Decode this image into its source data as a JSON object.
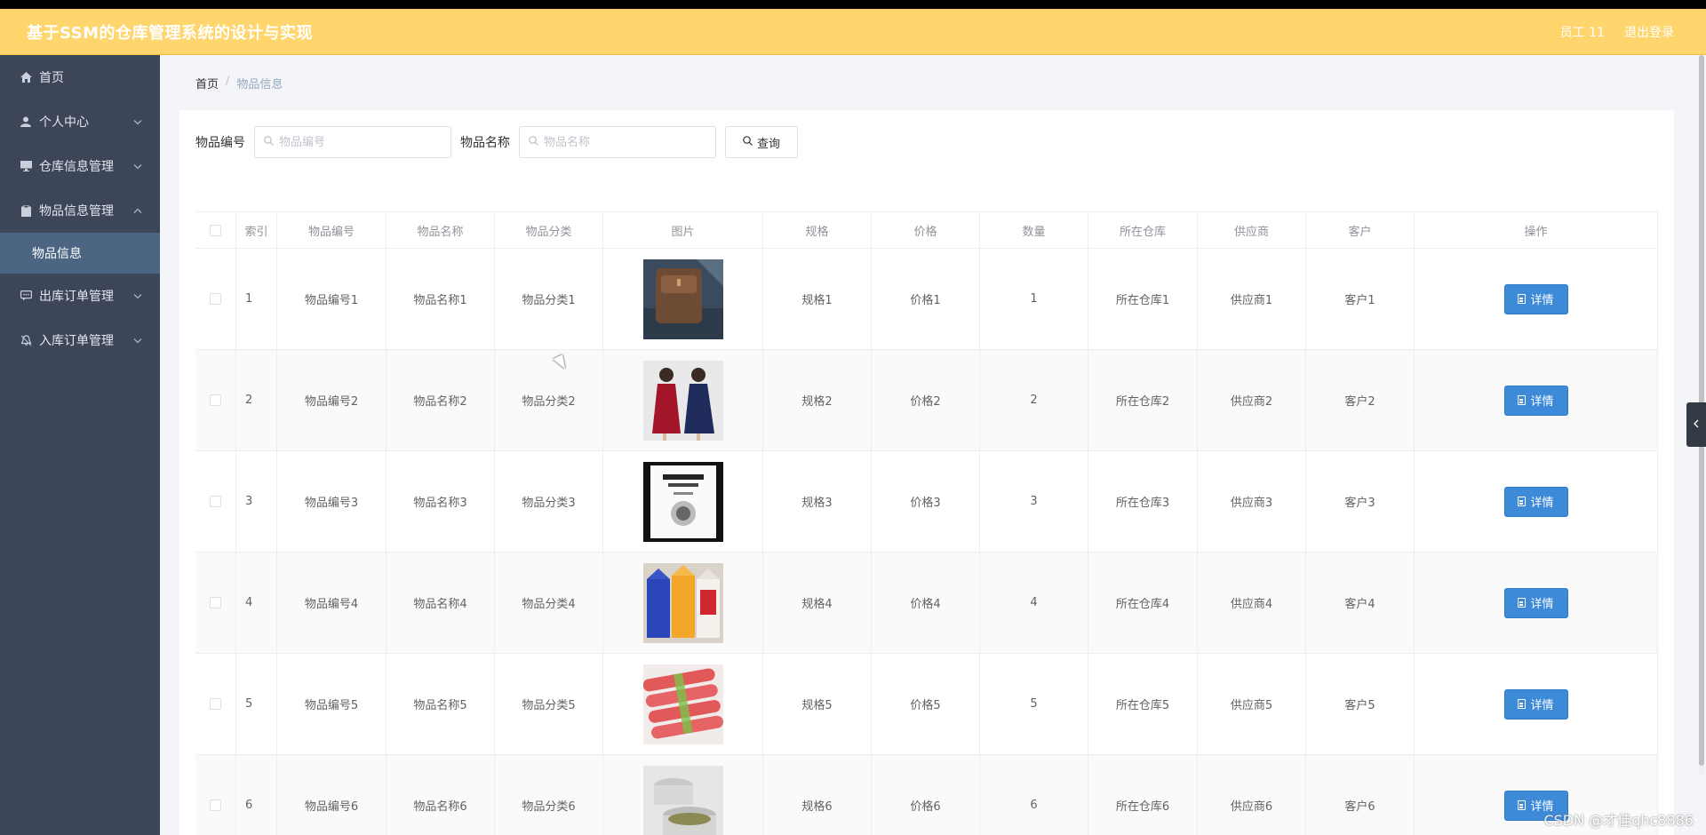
{
  "header": {
    "title": "基于SSM的仓库管理系统的设计与实现",
    "user": "员工 11",
    "logout": "退出登录"
  },
  "sidebar": {
    "items": [
      {
        "label": "首页",
        "icon": "home-icon",
        "expandable": false
      },
      {
        "label": "个人中心",
        "icon": "user-icon",
        "expandable": true
      },
      {
        "label": "仓库信息管理",
        "icon": "monitor-icon",
        "expandable": true
      },
      {
        "label": "物品信息管理",
        "icon": "clipboard-icon",
        "expandable": true,
        "expanded": true,
        "children": [
          "物品信息"
        ]
      },
      {
        "label": "出库订单管理",
        "icon": "chat-icon",
        "expandable": true
      },
      {
        "label": "入库订单管理",
        "icon": "bell-icon",
        "expandable": true
      }
    ]
  },
  "breadcrumb": {
    "home": "首页",
    "separator": "/",
    "current": "物品信息"
  },
  "search": {
    "code_label": "物品编号",
    "code_placeholder": "物品编号",
    "name_label": "物品名称",
    "name_placeholder": "物品名称",
    "query_label": "查询"
  },
  "table": {
    "columns": [
      "索引",
      "物品编号",
      "物品名称",
      "物品分类",
      "图片",
      "规格",
      "价格",
      "数量",
      "所在仓库",
      "供应商",
      "客户",
      "操作"
    ],
    "detail_label": "详情",
    "rows": [
      {
        "index": "1",
        "code": "物品编号1",
        "name": "物品名称1",
        "category": "物品分类1",
        "image": "brown-bag",
        "spec": "规格1",
        "price": "价格1",
        "qty": "1",
        "warehouse": "所在仓库1",
        "supplier": "供应商1",
        "customer": "客户1"
      },
      {
        "index": "2",
        "code": "物品编号2",
        "name": "物品名称2",
        "category": "物品分类2",
        "image": "two-women-dresses",
        "spec": "规格2",
        "price": "价格2",
        "qty": "2",
        "warehouse": "所在仓库2",
        "supplier": "供应商2",
        "customer": "客户2"
      },
      {
        "index": "3",
        "code": "物品编号3",
        "name": "物品名称3",
        "category": "物品分类3",
        "image": "book-cover",
        "spec": "规格3",
        "price": "价格3",
        "qty": "3",
        "warehouse": "所在仓库3",
        "supplier": "供应商3",
        "customer": "客户3"
      },
      {
        "index": "4",
        "code": "物品编号4",
        "name": "物品名称4",
        "category": "物品分类4",
        "image": "drink-cartons",
        "spec": "规格4",
        "price": "价格4",
        "qty": "4",
        "warehouse": "所在仓库4",
        "supplier": "供应商4",
        "customer": "客户4"
      },
      {
        "index": "5",
        "code": "物品编号5",
        "name": "物品名称5",
        "category": "物品分类5",
        "image": "sausages",
        "spec": "规格5",
        "price": "价格5",
        "qty": "5",
        "warehouse": "所在仓库5",
        "supplier": "供应商5",
        "customer": "客户5"
      },
      {
        "index": "6",
        "code": "物品编号6",
        "name": "物品名称6",
        "category": "物品分类6",
        "image": "cream-jars",
        "spec": "规格6",
        "price": "价格6",
        "qty": "6",
        "warehouse": "所在仓库6",
        "supplier": "供应商6",
        "customer": "客户6"
      }
    ]
  },
  "watermark": "CSDN @才佳qhc8886",
  "colors": {
    "header": "#ffd66e",
    "sidebar": "#3d4559",
    "submenu_active": "#4b6582",
    "primary_button": "#3d8ad8"
  }
}
